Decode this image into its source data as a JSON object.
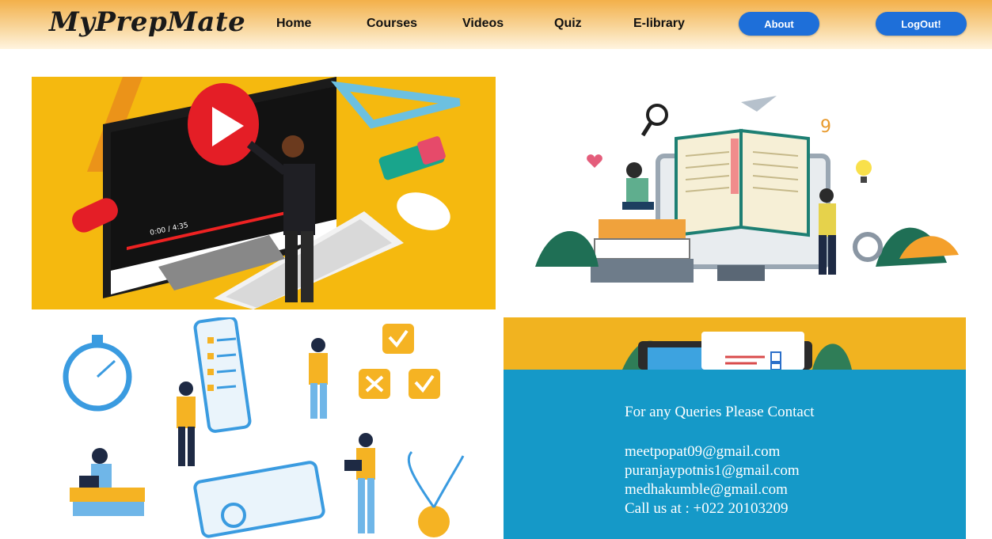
{
  "brand": {
    "name": "MyPrepMate"
  },
  "nav": {
    "items": [
      {
        "label": "Home"
      },
      {
        "label": "Courses"
      },
      {
        "label": "Videos"
      },
      {
        "label": "Quiz"
      },
      {
        "label": "E-library"
      }
    ],
    "about_label": "About",
    "logout_label": "LogOut!"
  },
  "tiles": {
    "video": {
      "player_time": "0:00 / 4:35"
    }
  },
  "contact": {
    "heading": "For any Queries Please Contact",
    "emails": [
      "meetpopat09@gmail.com",
      "puranjaypotnis1@gmail.com",
      "medhakumble@gmail.com"
    ],
    "phone": "Call us at : +022 20103209"
  },
  "colors": {
    "header_orange": "#f3b04a",
    "button_blue": "#1e6fd9",
    "contact_blue": "#1599c8",
    "video_yellow": "#f5b90f"
  },
  "icons": [
    "play-icon",
    "magnifier-icon",
    "paper-plane-icon",
    "lightbulb-icon",
    "heart-icon",
    "stopwatch-icon",
    "checkbox-icon",
    "cross-icon"
  ]
}
